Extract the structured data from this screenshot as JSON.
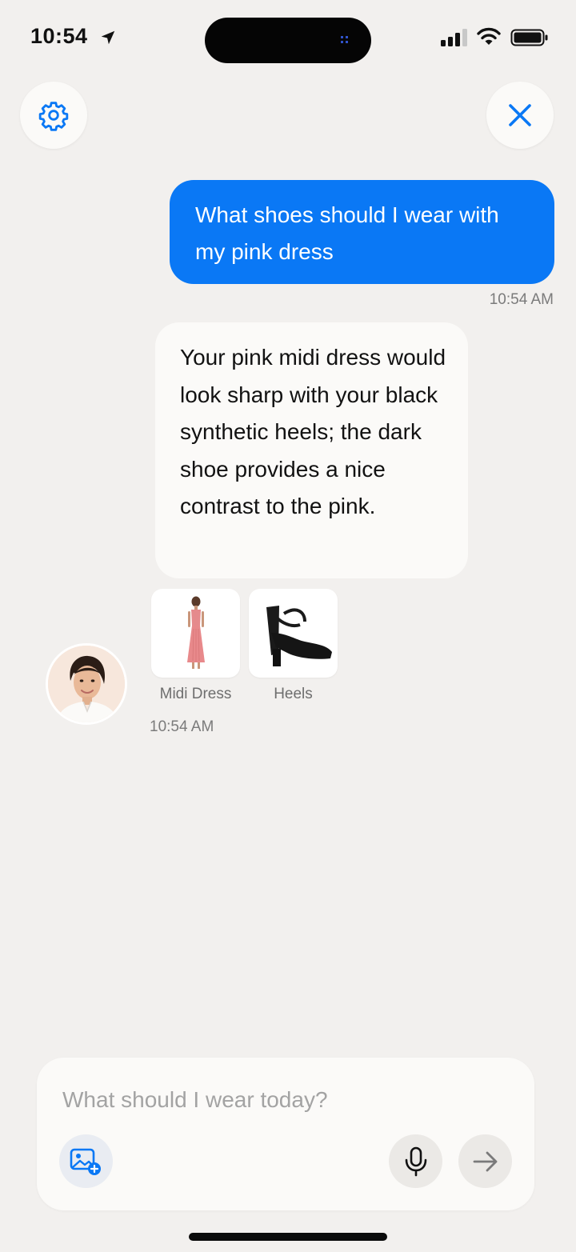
{
  "status_bar": {
    "time": "10:54"
  },
  "header": {
    "settings_icon": "gear-icon",
    "close_icon": "close-icon",
    "accent_color": "#0a78f5"
  },
  "messages": [
    {
      "role": "user",
      "text": "What shoes should I wear with my pink dress",
      "timestamp": "10:54 AM"
    },
    {
      "role": "assistant",
      "text": "Your pink midi dress would look sharp with your black synthetic heels; the dark shoe provides a nice contrast to the pink.",
      "products": [
        {
          "label": "Midi Dress"
        },
        {
          "label": "Heels"
        }
      ],
      "timestamp": "10:54 AM"
    }
  ],
  "composer": {
    "placeholder": "What should I wear today?",
    "value": ""
  },
  "colors": {
    "background": "#f2f0ee",
    "user_bubble": "#0a78f5",
    "assistant_bubble": "#fbfaf8"
  }
}
